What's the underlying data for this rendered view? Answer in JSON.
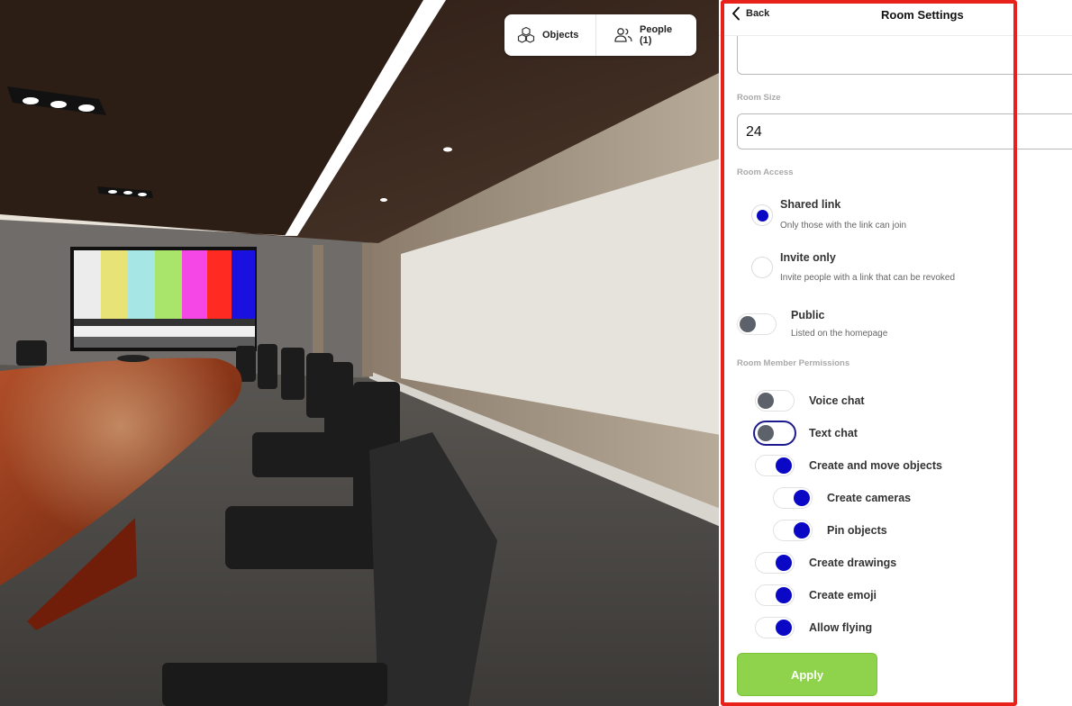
{
  "toolbar": {
    "objects_label": "Objects",
    "people_label": "People (1)"
  },
  "panel": {
    "back_label": "Back",
    "title": "Room Settings",
    "room_size_label": "Room Size",
    "room_size_value": "24",
    "room_access_label": "Room Access",
    "access_options": [
      {
        "title": "Shared link",
        "subtitle": "Only those with the link can join",
        "selected": true
      },
      {
        "title": "Invite only",
        "subtitle": "Invite people with a link that can be revoked",
        "selected": false
      }
    ],
    "public": {
      "title": "Public",
      "subtitle": "Listed on the homepage",
      "enabled": false
    },
    "permissions_label": "Room Member Permissions",
    "permissions": [
      {
        "label": "Voice chat",
        "enabled": false
      },
      {
        "label": "Text chat",
        "enabled": false
      },
      {
        "label": "Create and move objects",
        "enabled": true
      },
      {
        "label": "Create cameras",
        "enabled": true
      },
      {
        "label": "Pin objects",
        "enabled": true
      },
      {
        "label": "Create drawings",
        "enabled": true
      },
      {
        "label": "Create emoji",
        "enabled": true
      },
      {
        "label": "Allow flying",
        "enabled": true
      }
    ],
    "apply_label": "Apply"
  },
  "colors": {
    "accent": "#0a08c4",
    "apply": "#8ed34b",
    "highlight": "#e8221a",
    "toggle_off_knob": "#5d6169"
  },
  "icons": [
    "objects-icon",
    "people-icon",
    "back-chevron-icon"
  ]
}
